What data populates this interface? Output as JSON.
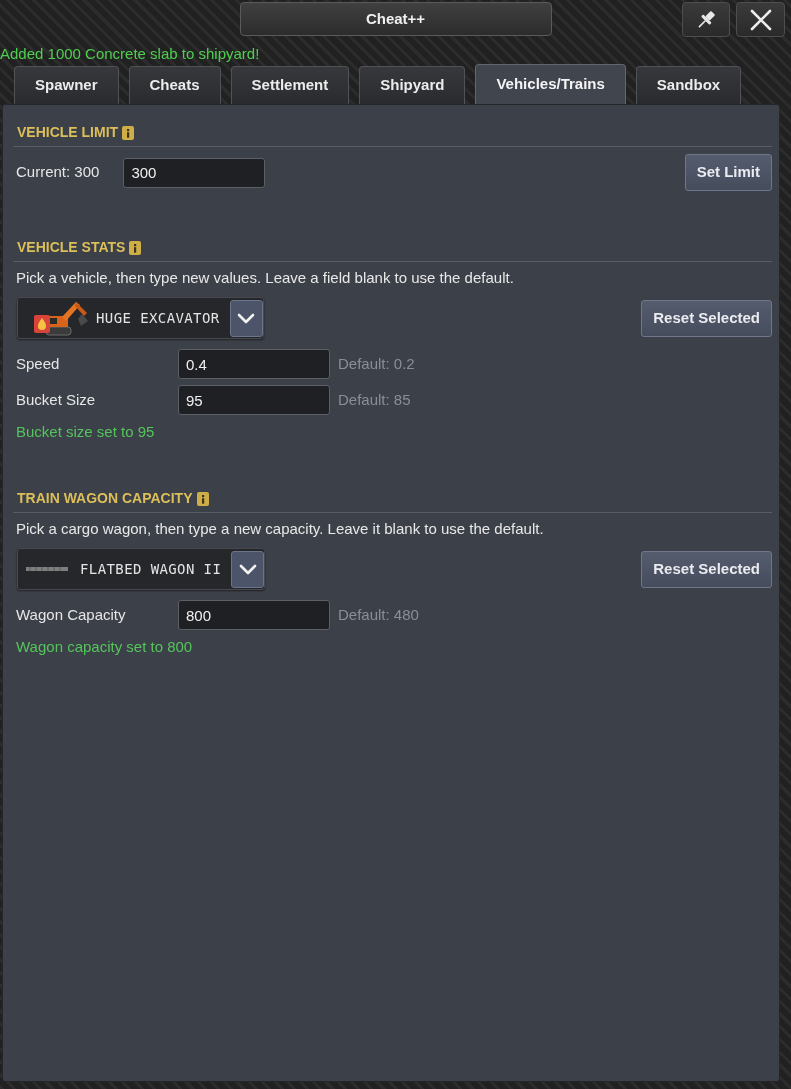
{
  "window": {
    "title": "Cheat++"
  },
  "status_message": "Added 1000 Concrete slab to shipyard!",
  "tabs": [
    {
      "label": "Spawner",
      "selected": false
    },
    {
      "label": "Cheats",
      "selected": false
    },
    {
      "label": "Settlement",
      "selected": false
    },
    {
      "label": "Shipyard",
      "selected": false
    },
    {
      "label": "Vehicles/Trains",
      "selected": true
    },
    {
      "label": "Sandbox",
      "selected": false
    }
  ],
  "sections": [
    {
      "kind": "limit",
      "title": "VEHICLE LIMIT",
      "current": "Current: 300",
      "input_value": "300",
      "button": "Set Limit"
    },
    {
      "kind": "vehicle",
      "title": "VEHICLE STATS",
      "description": "Pick a vehicle, then type new values. Leave a field blank to use the default.",
      "selection": "HUGE EXCAVATOR",
      "button": "Reset Selected",
      "fields": [
        {
          "label": "Speed",
          "value": "0.4",
          "default": "Default: 0.2"
        },
        {
          "label": "Bucket Size",
          "value": "95",
          "default": "Default: 85"
        }
      ],
      "message": "Bucket size set to 95"
    },
    {
      "kind": "wagon",
      "title": "TRAIN WAGON CAPACITY",
      "description": "Pick a cargo wagon, then type a new capacity. Leave it blank to use the default.",
      "selection": "FLATBED WAGON II",
      "button": "Reset Selected",
      "fields": [
        {
          "label": "Wagon Capacity",
          "value": "800",
          "default": "Default: 480"
        }
      ],
      "message": "Wagon capacity set to 800"
    }
  ]
}
